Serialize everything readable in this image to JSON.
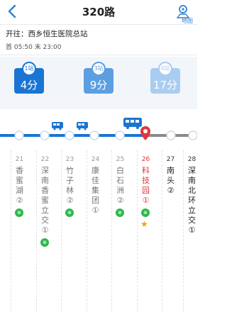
{
  "header": {
    "title": "320路",
    "map_label": "地图"
  },
  "info": {
    "destination": "开往：西乡恒生医院总站",
    "times": "首 05:50 末 23:00"
  },
  "countdown": [
    {
      "badge": "1站",
      "value": "4分"
    },
    {
      "badge": "3站",
      "value": "9分"
    },
    {
      "badge": "4站",
      "value": "17分"
    }
  ],
  "stations": [
    {
      "num": "21",
      "name": "香蜜湖②"
    },
    {
      "num": "22",
      "name": "深南香蜜立交①"
    },
    {
      "num": "23",
      "name": "竹子林②"
    },
    {
      "num": "24",
      "name": "康佳集团①"
    },
    {
      "num": "25",
      "name": "白石洲②"
    },
    {
      "num": "26",
      "name": "科技园①"
    },
    {
      "num": "27",
      "name": "南头②"
    },
    {
      "num": "28",
      "name": "深南北环立交①"
    }
  ],
  "colors": {
    "accent_blue": "#1a75d2",
    "active_red": "#e0363a",
    "metro_green": "#2db84d"
  }
}
